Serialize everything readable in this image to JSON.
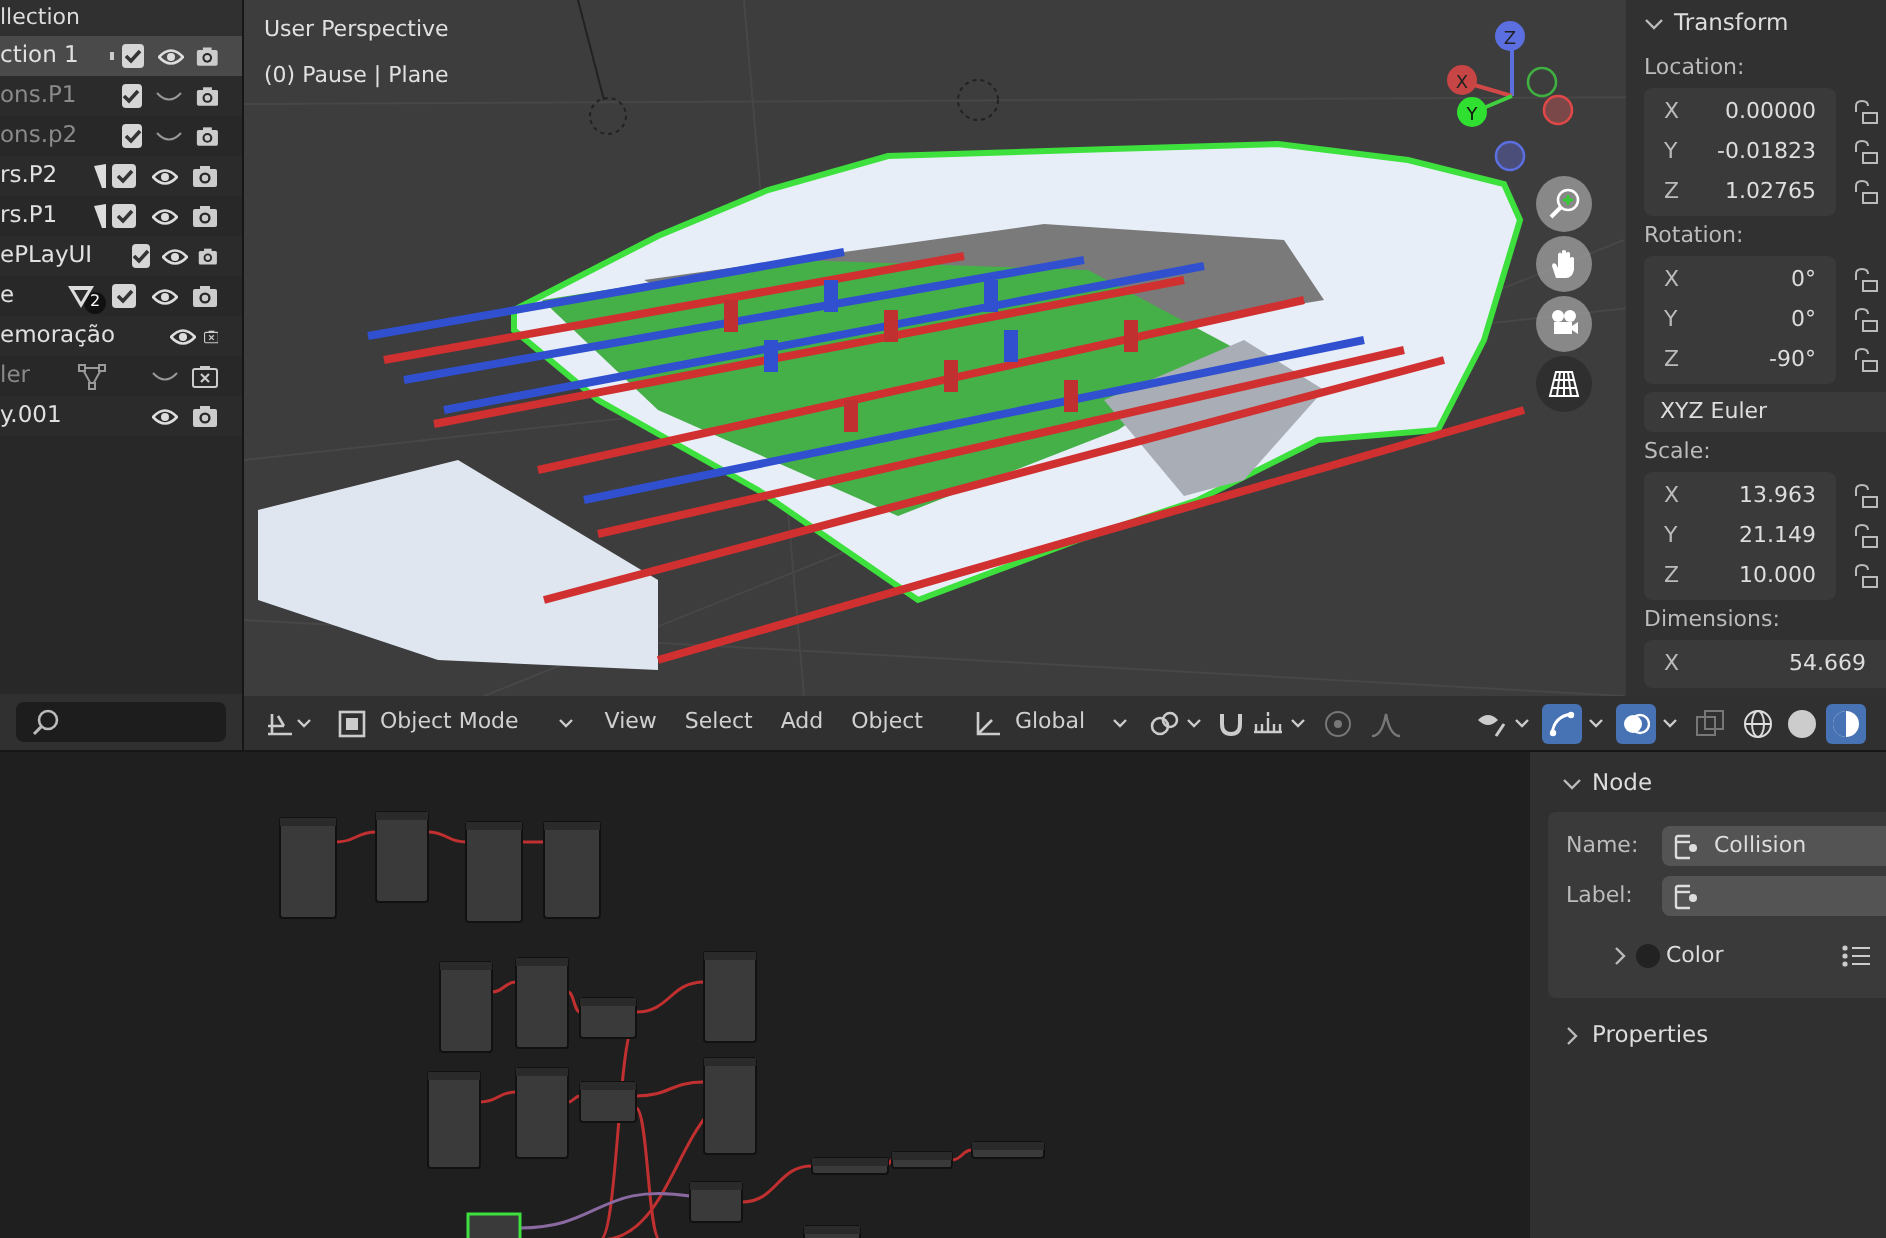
{
  "outliner": {
    "header": "llection",
    "rows": [
      {
        "label": "ction 1",
        "selected": true,
        "dimmed": false,
        "kind": "dot",
        "checkbox": true,
        "visible": true,
        "renderable": true
      },
      {
        "label": "ons.P1",
        "selected": false,
        "dimmed": true,
        "kind": "plain",
        "checkbox": true,
        "visible": false,
        "renderable": true
      },
      {
        "label": "ons.p2",
        "selected": false,
        "dimmed": true,
        "kind": "plain",
        "checkbox": true,
        "visible": false,
        "renderable": true
      },
      {
        "label": "rs.P2",
        "selected": false,
        "dimmed": false,
        "kind": "wedge",
        "checkbox": true,
        "visible": true,
        "renderable": true
      },
      {
        "label": "rs.P1",
        "selected": false,
        "dimmed": false,
        "kind": "wedge",
        "checkbox": true,
        "visible": true,
        "renderable": true
      },
      {
        "label": "ePLayUI",
        "selected": false,
        "dimmed": false,
        "kind": "plain",
        "checkbox": true,
        "visible": true,
        "renderable": true
      },
      {
        "label": "e",
        "selected": false,
        "dimmed": false,
        "kind": "funnel",
        "badge": "2",
        "checkbox": true,
        "visible": true,
        "renderable": true
      },
      {
        "label": "emoração",
        "selected": false,
        "dimmed": false,
        "kind": "plain",
        "checkbox": false,
        "visible": true,
        "renderable": false
      },
      {
        "label": "ler",
        "selected": false,
        "dimmed": true,
        "kind": "vertices",
        "checkbox": false,
        "visible": false,
        "renderable": false
      },
      {
        "label": "y.001",
        "selected": false,
        "dimmed": false,
        "kind": "plain",
        "checkbox": false,
        "visible": true,
        "renderable": true
      }
    ]
  },
  "viewport": {
    "view_name": "User Perspective",
    "object_info": "(0) Pause | Plane",
    "gizmo_axes": [
      "X",
      "Y",
      "Z"
    ]
  },
  "transform": {
    "title": "Transform",
    "expanded": true,
    "groups": [
      {
        "label": "Location:",
        "fields": [
          {
            "axis": "X",
            "value": "0.00000"
          },
          {
            "axis": "Y",
            "value": "-0.01823"
          },
          {
            "axis": "Z",
            "value": "1.02765"
          }
        ]
      },
      {
        "label": "Rotation:",
        "fields": [
          {
            "axis": "X",
            "value": "0°"
          },
          {
            "axis": "Y",
            "value": "0°"
          },
          {
            "axis": "Z",
            "value": "-90°"
          }
        ],
        "mode": "XYZ Euler"
      },
      {
        "label": "Scale:",
        "fields": [
          {
            "axis": "X",
            "value": "13.963"
          },
          {
            "axis": "Y",
            "value": "21.149"
          },
          {
            "axis": "Z",
            "value": "10.000"
          }
        ]
      },
      {
        "label": "Dimensions:",
        "fields": [
          {
            "axis": "X",
            "value": "54.669"
          }
        ]
      }
    ]
  },
  "header_bar": {
    "mode": "Object Mode",
    "menus": [
      "View",
      "Select",
      "Add",
      "Object"
    ],
    "orientation": "Global",
    "gizmos_on": true,
    "overlays_on": true,
    "shading_modes": [
      {
        "kind": "wireframe",
        "selected": false
      },
      {
        "kind": "solid",
        "selected": false
      },
      {
        "kind": "material",
        "selected": true
      }
    ]
  },
  "node_sidebar": {
    "node_panel": {
      "title": "Node",
      "expanded": true,
      "name_label": "Name:",
      "name_value": "Collision",
      "label_label": "Label:",
      "color_label": "Color",
      "color_expanded": false
    },
    "properties_panel": {
      "title": "Properties",
      "expanded": false
    }
  }
}
